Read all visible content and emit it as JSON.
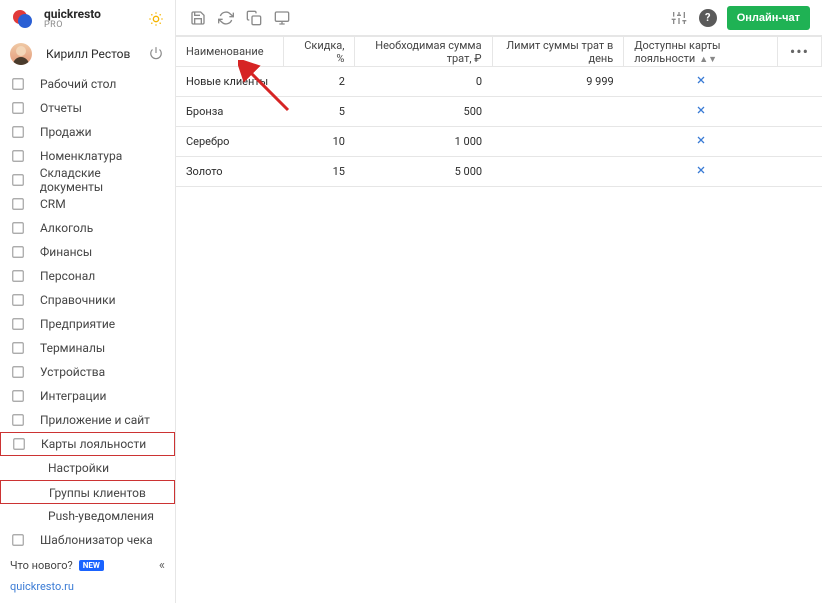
{
  "app": {
    "name": "quickresto",
    "tier": "PRO"
  },
  "user": {
    "name": "Кирилл Рестов"
  },
  "nav": {
    "items": [
      {
        "label": "Рабочий стол",
        "icon": "dashboard-icon"
      },
      {
        "label": "Отчеты",
        "icon": "reports-icon"
      },
      {
        "label": "Продажи",
        "icon": "sales-icon"
      },
      {
        "label": "Номенклатура",
        "icon": "nomenclature-icon"
      },
      {
        "label": "Складские документы",
        "icon": "warehouse-icon"
      },
      {
        "label": "CRM",
        "icon": "crm-icon"
      },
      {
        "label": "Алкоголь",
        "icon": "alcohol-icon"
      },
      {
        "label": "Финансы",
        "icon": "finance-icon"
      },
      {
        "label": "Персонал",
        "icon": "staff-icon"
      },
      {
        "label": "Справочники",
        "icon": "directories-icon"
      },
      {
        "label": "Предприятие",
        "icon": "enterprise-icon"
      },
      {
        "label": "Терминалы",
        "icon": "terminals-icon"
      },
      {
        "label": "Устройства",
        "icon": "devices-icon"
      },
      {
        "label": "Интеграции",
        "icon": "integrations-icon"
      },
      {
        "label": "Приложение и сайт",
        "icon": "app-site-icon"
      },
      {
        "label": "Карты лояльности",
        "icon": "loyalty-icon",
        "highlighted": true
      },
      {
        "label": "Шаблонизатор чека",
        "icon": "receipt-template-icon"
      }
    ],
    "loyalty_sub": [
      {
        "label": "Настройки"
      },
      {
        "label": "Группы клиентов",
        "highlighted": true
      },
      {
        "label": "Push-уведомления"
      }
    ]
  },
  "footer": {
    "whatsnew": "Что нового?",
    "new_badge": "NEW",
    "site": "quickresto.ru"
  },
  "toolbar": {
    "chat_label": "Онлайн-чат"
  },
  "table": {
    "headers": {
      "name": "Наименование",
      "discount": "Скидка, %",
      "spend_sum": "Необходимая сумма трат, ₽",
      "limit_day": "Лимит суммы трат в день",
      "loyalty_cards": "Доступны карты лояльности"
    },
    "rows": [
      {
        "name": "Новые клиенты",
        "discount": "2",
        "spend_sum": "0",
        "limit_day": "9 999",
        "cards": false
      },
      {
        "name": "Бронза",
        "discount": "5",
        "spend_sum": "500",
        "limit_day": "",
        "cards": false
      },
      {
        "name": "Серебро",
        "discount": "10",
        "spend_sum": "1 000",
        "limit_day": "",
        "cards": false
      },
      {
        "name": "Золото",
        "discount": "15",
        "spend_sum": "5 000",
        "limit_day": "",
        "cards": false
      }
    ]
  },
  "colors": {
    "accent": "#1fb254",
    "link": "#3a7bd5",
    "highlight_border": "#cc3333"
  }
}
